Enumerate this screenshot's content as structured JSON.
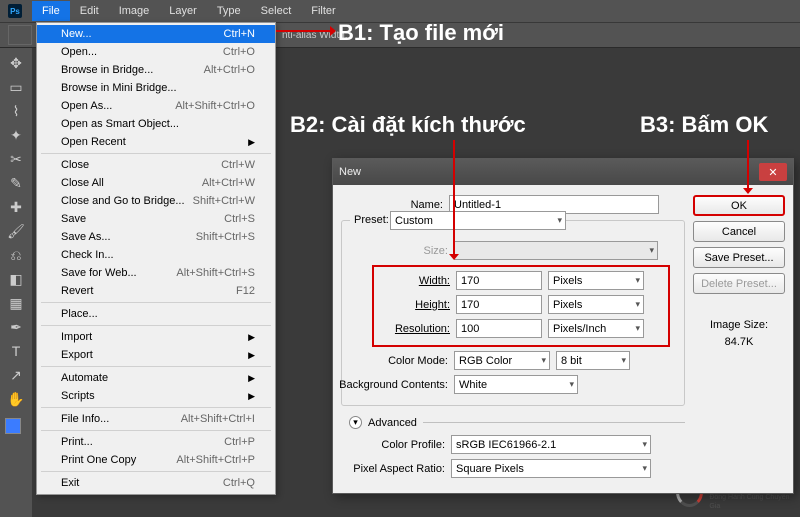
{
  "menubar": [
    "File",
    "Edit",
    "Image",
    "Layer",
    "Type",
    "Select",
    "Filter"
  ],
  "options_bar": {
    "alias": "nti-alias Width:"
  },
  "annotations": {
    "b1": "B1: Tạo file mới",
    "b2": "B2: Cài đặt kích thước",
    "b3": "B3: Bấm OK"
  },
  "file_menu": [
    {
      "label": "New...",
      "shortcut": "Ctrl+N",
      "hl": true
    },
    {
      "label": "Open...",
      "shortcut": "Ctrl+O"
    },
    {
      "label": "Browse in Bridge...",
      "shortcut": "Alt+Ctrl+O"
    },
    {
      "label": "Browse in Mini Bridge..."
    },
    {
      "label": "Open As...",
      "shortcut": "Alt+Shift+Ctrl+O"
    },
    {
      "label": "Open as Smart Object..."
    },
    {
      "label": "Open Recent",
      "sub": true
    },
    {
      "sep": true
    },
    {
      "label": "Close",
      "shortcut": "Ctrl+W"
    },
    {
      "label": "Close All",
      "shortcut": "Alt+Ctrl+W"
    },
    {
      "label": "Close and Go to Bridge...",
      "shortcut": "Shift+Ctrl+W"
    },
    {
      "label": "Save",
      "shortcut": "Ctrl+S"
    },
    {
      "label": "Save As...",
      "shortcut": "Shift+Ctrl+S"
    },
    {
      "label": "Check In..."
    },
    {
      "label": "Save for Web...",
      "shortcut": "Alt+Shift+Ctrl+S"
    },
    {
      "label": "Revert",
      "shortcut": "F12"
    },
    {
      "sep": true
    },
    {
      "label": "Place..."
    },
    {
      "sep": true
    },
    {
      "label": "Import",
      "sub": true
    },
    {
      "label": "Export",
      "sub": true
    },
    {
      "sep": true
    },
    {
      "label": "Automate",
      "sub": true
    },
    {
      "label": "Scripts",
      "sub": true
    },
    {
      "sep": true
    },
    {
      "label": "File Info...",
      "shortcut": "Alt+Shift+Ctrl+I"
    },
    {
      "sep": true
    },
    {
      "label": "Print...",
      "shortcut": "Ctrl+P"
    },
    {
      "label": "Print One Copy",
      "shortcut": "Alt+Shift+Ctrl+P"
    },
    {
      "sep": true
    },
    {
      "label": "Exit",
      "shortcut": "Ctrl+Q"
    }
  ],
  "dialog": {
    "title": "New",
    "name_label": "Name:",
    "name_value": "Untitled-1",
    "preset_label": "Preset:",
    "preset_value": "Custom",
    "size_label": "Size:",
    "width_label": "Width:",
    "width_value": "170",
    "width_unit": "Pixels",
    "height_label": "Height:",
    "height_value": "170",
    "height_unit": "Pixels",
    "res_label": "Resolution:",
    "res_value": "100",
    "res_unit": "Pixels/Inch",
    "colormode_label": "Color Mode:",
    "colormode_value": "RGB Color",
    "colormode_depth": "8 bit",
    "bg_label": "Background Contents:",
    "bg_value": "White",
    "advanced_label": "Advanced",
    "profile_label": "Color Profile:",
    "profile_value": "sRGB IEC61966-2.1",
    "aspect_label": "Pixel Aspect Ratio:",
    "aspect_value": "Square Pixels",
    "ok": "OK",
    "cancel": "Cancel",
    "save_preset": "Save Preset...",
    "delete_preset": "Delete Preset...",
    "imgsize_label": "Image Size:",
    "imgsize_value": "84.7K"
  },
  "watermark": {
    "brand": "Quảng Cáo Siêu Tốc",
    "tagline": "Đồng Hành Cùng Chuyên Gia"
  }
}
